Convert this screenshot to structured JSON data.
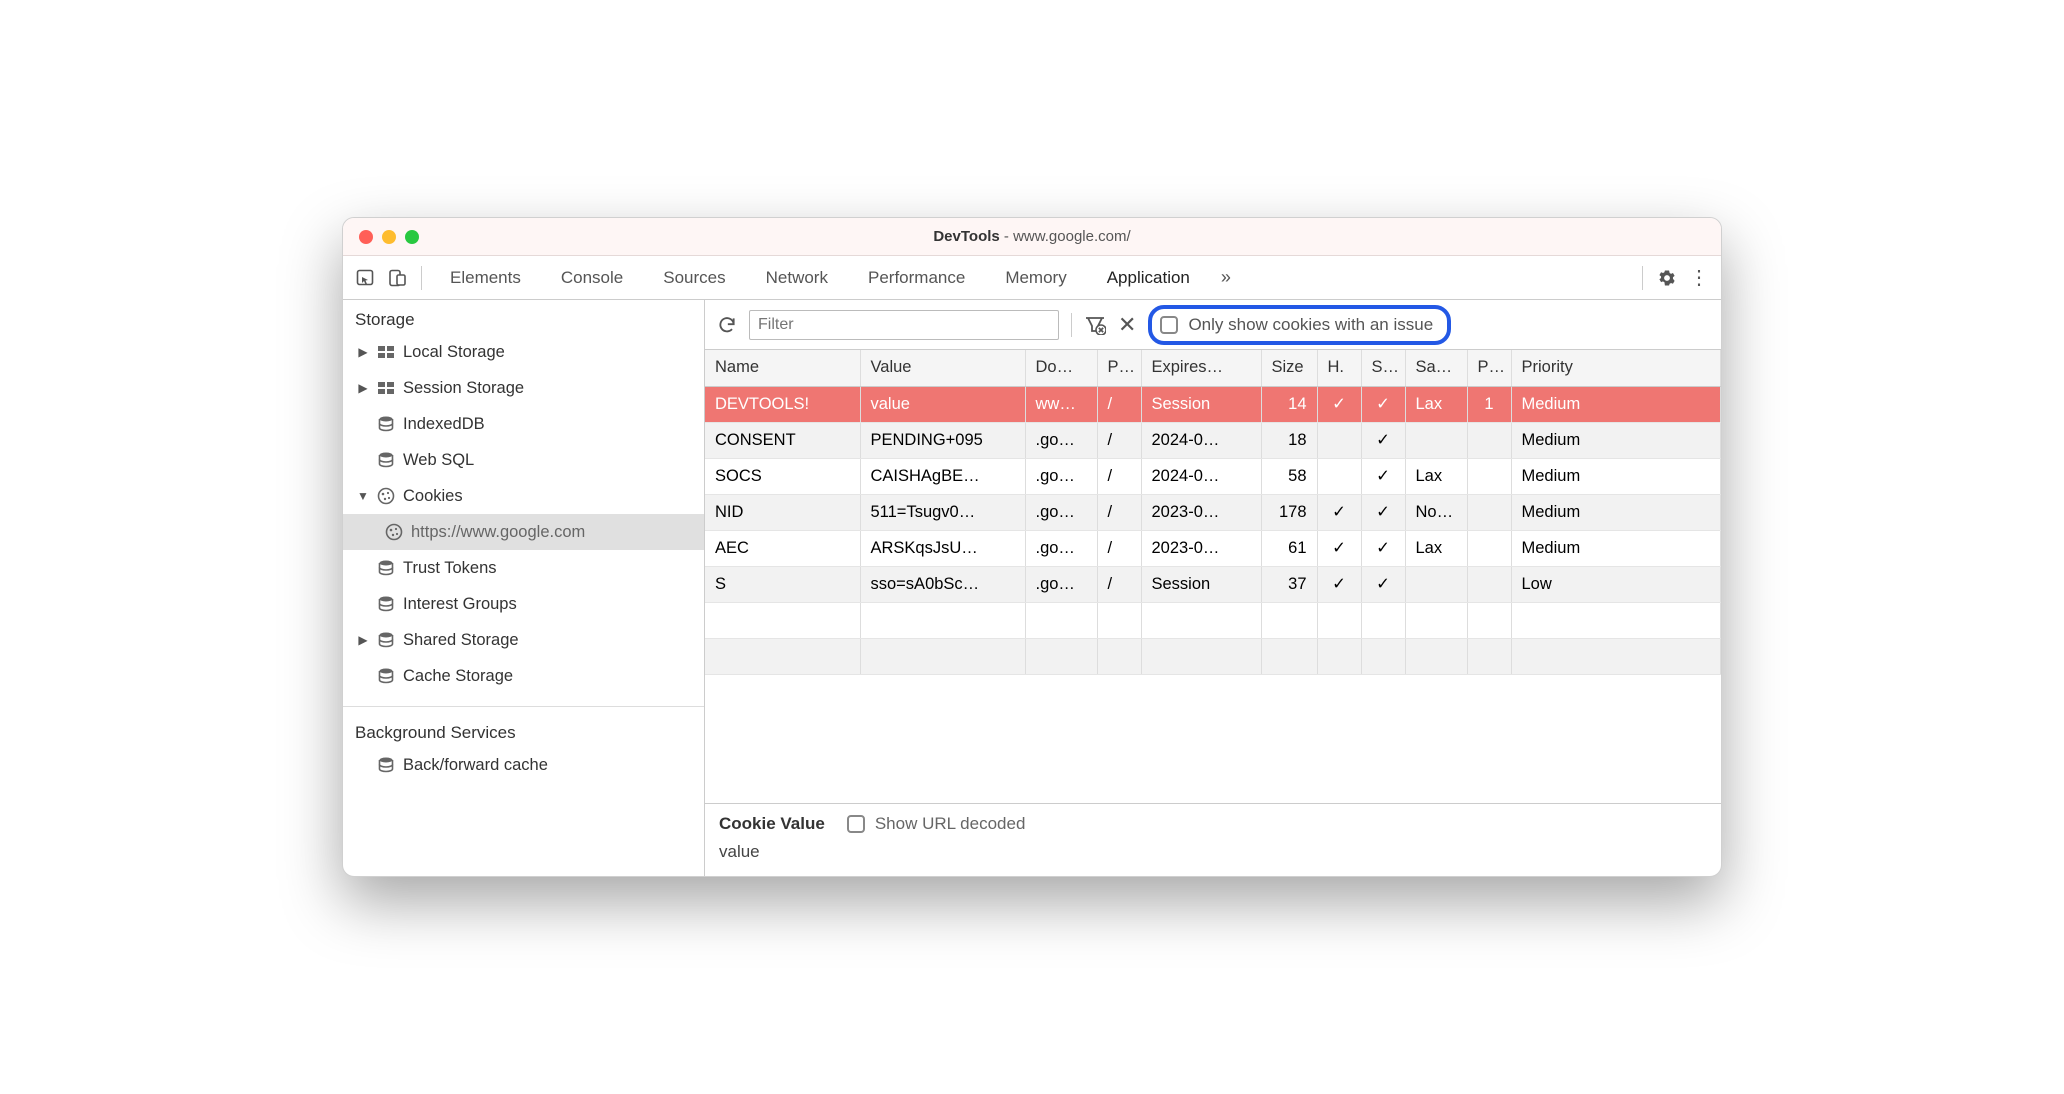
{
  "window": {
    "title_prefix": "DevTools",
    "title_site": "www.google.com/"
  },
  "tabs": {
    "items": [
      "Elements",
      "Console",
      "Sources",
      "Network",
      "Performance",
      "Memory",
      "Application"
    ],
    "active": "Application"
  },
  "toolbar": {
    "filter_placeholder": "Filter",
    "only_issues_label": "Only show cookies with an issue"
  },
  "sidebar": {
    "section1_title": "Storage",
    "section2_title": "Background Services",
    "items": [
      {
        "label": "Local Storage",
        "icon": "grid",
        "arrow": "right"
      },
      {
        "label": "Session Storage",
        "icon": "grid",
        "arrow": "right"
      },
      {
        "label": "IndexedDB",
        "icon": "db",
        "arrow": "none"
      },
      {
        "label": "Web SQL",
        "icon": "db",
        "arrow": "none"
      },
      {
        "label": "Cookies",
        "icon": "cookie",
        "arrow": "down"
      },
      {
        "label": "https://www.google.com",
        "icon": "cookie",
        "arrow": "none",
        "child": true,
        "selected": true
      },
      {
        "label": "Trust Tokens",
        "icon": "db",
        "arrow": "none"
      },
      {
        "label": "Interest Groups",
        "icon": "db",
        "arrow": "none"
      },
      {
        "label": "Shared Storage",
        "icon": "db",
        "arrow": "right"
      },
      {
        "label": "Cache Storage",
        "icon": "db",
        "arrow": "none"
      }
    ],
    "bg_items": [
      {
        "label": "Back/forward cache",
        "icon": "db",
        "arrow": "none"
      }
    ]
  },
  "columns": [
    "Name",
    "Value",
    "Do…",
    "P…",
    "Expires…",
    "Size",
    "H.",
    "S…",
    "Sa…",
    "P…",
    "Priority"
  ],
  "rows": [
    {
      "name": "DEVTOOLS!",
      "value": "value",
      "domain": "ww…",
      "path": "/",
      "expires": "Session",
      "size": "14",
      "http": "✓",
      "secure": "✓",
      "same": "Lax",
      "pk": "1",
      "priority": "Medium",
      "selected": true
    },
    {
      "name": "CONSENT",
      "value": "PENDING+095",
      "domain": ".go…",
      "path": "/",
      "expires": "2024-0…",
      "size": "18",
      "http": "",
      "secure": "✓",
      "same": "",
      "pk": "",
      "priority": "Medium"
    },
    {
      "name": "SOCS",
      "value": "CAISHAgBE…",
      "domain": ".go…",
      "path": "/",
      "expires": "2024-0…",
      "size": "58",
      "http": "",
      "secure": "✓",
      "same": "Lax",
      "pk": "",
      "priority": "Medium"
    },
    {
      "name": "NID",
      "value": "511=Tsugv0…",
      "domain": ".go…",
      "path": "/",
      "expires": "2023-0…",
      "size": "178",
      "http": "✓",
      "secure": "✓",
      "same": "No…",
      "pk": "",
      "priority": "Medium"
    },
    {
      "name": "AEC",
      "value": "ARSKqsJsU…",
      "domain": ".go…",
      "path": "/",
      "expires": "2023-0…",
      "size": "61",
      "http": "✓",
      "secure": "✓",
      "same": "Lax",
      "pk": "",
      "priority": "Medium"
    },
    {
      "name": "S",
      "value": "sso=sA0bSc…",
      "domain": ".go…",
      "path": "/",
      "expires": "Session",
      "size": "37",
      "http": "✓",
      "secure": "✓",
      "same": "",
      "pk": "",
      "priority": "Low"
    }
  ],
  "detail": {
    "label": "Cookie Value",
    "show_decoded_label": "Show URL decoded",
    "value": "value"
  }
}
